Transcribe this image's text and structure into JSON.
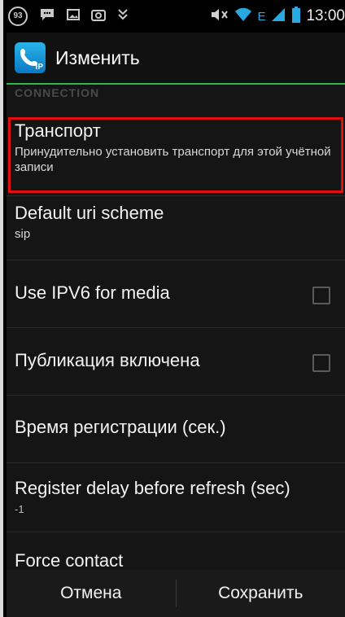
{
  "status_bar": {
    "badge_text": "93",
    "icons": [
      "notification-badge-icon",
      "chat-icon",
      "image-icon",
      "screenshot-icon",
      "download-icon",
      "mute-icon",
      "wifi-icon",
      "network-e-icon",
      "signal-icon",
      "battery-icon"
    ],
    "network_label": "E",
    "time": "13:00"
  },
  "action_bar": {
    "icon_text": "IP",
    "title": "Изменить"
  },
  "section": {
    "header": "CONNECTION"
  },
  "items": [
    {
      "title": "Транспорт",
      "summary": "Принудительно установить транспорт для этой учётной записи"
    },
    {
      "title": "Default uri scheme",
      "summary": "sip"
    },
    {
      "title": "Use IPV6 for media",
      "checked": false
    },
    {
      "title": "Публикация включена",
      "checked": false
    },
    {
      "title": "Время регистрации (сек.)"
    },
    {
      "title": "Register delay before refresh (sec)",
      "summary": "-1"
    },
    {
      "title": "Force contact"
    }
  ],
  "bottom_bar": {
    "cancel": "Отмена",
    "save": "Сохранить"
  },
  "colors": {
    "accent_green": "#33b44a",
    "highlight_red": "#e01010",
    "icon_blue": "#1a9ad8"
  }
}
